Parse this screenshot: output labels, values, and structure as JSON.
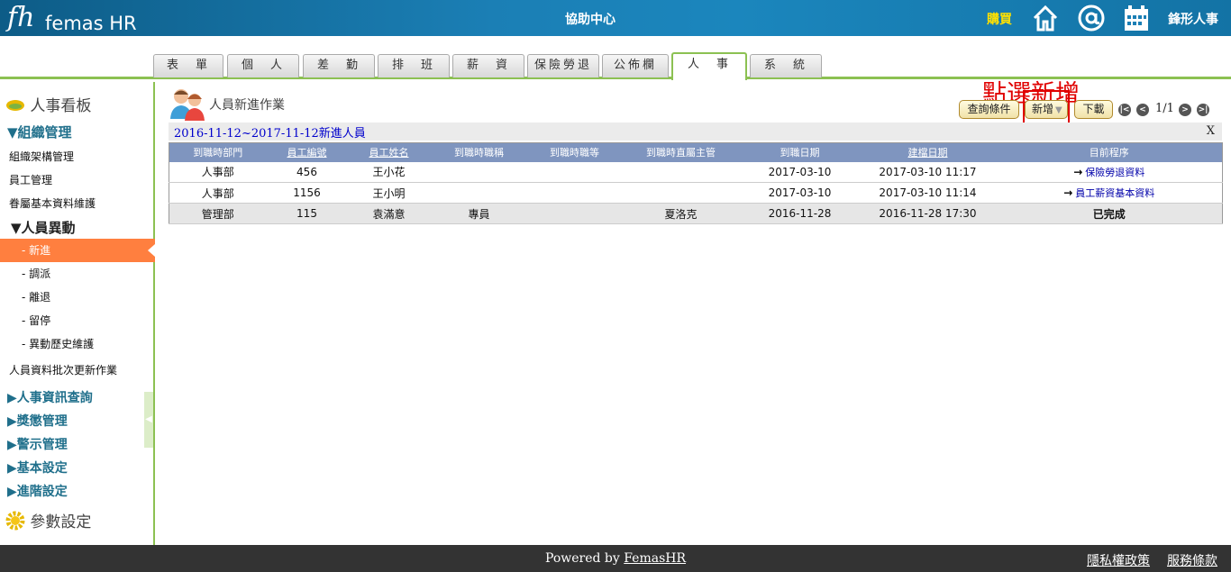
{
  "header": {
    "logo_mark": "fh",
    "logo_text": "femas HR",
    "help_center": "協助中心",
    "buy": "購買",
    "company": "鋒形人事",
    "icons": [
      "home-icon",
      "at-icon",
      "calendar-icon"
    ]
  },
  "tabs": [
    {
      "label": "表　單"
    },
    {
      "label": "個　人"
    },
    {
      "label": "差　勤"
    },
    {
      "label": "排　班"
    },
    {
      "label": "薪　資"
    },
    {
      "label": "保險勞退"
    },
    {
      "label": "公佈欄"
    },
    {
      "label": "人　事",
      "active": true
    },
    {
      "label": "系　統"
    }
  ],
  "annotation": "點選新增",
  "sidebar": {
    "board": "人事看板",
    "org_head": "▼組織管理",
    "org_items": [
      "組織架構管理",
      "員工管理",
      "眷屬基本資料維護"
    ],
    "change_head": "▼人員異動",
    "change_items": [
      "- 新進",
      "- 調派",
      "- 離退",
      "- 留停",
      "- 異動歷史維護"
    ],
    "batch": "人員資料批次更新作業",
    "sections": [
      "▶人事資訊查詢",
      "▶獎懲管理",
      "▶警示管理",
      "▶基本設定",
      "▶進階設定"
    ],
    "params": "參數設定"
  },
  "page": {
    "title": "人員新進作業",
    "buttons": {
      "query": "查詢條件",
      "add": "新增",
      "download": "下載"
    },
    "pager": {
      "first": "|<",
      "prev": "<",
      "next": ">",
      "last": ">|",
      "text": "1/1"
    },
    "range": "2016-11-12~2017-11-12新進人員",
    "close": "X"
  },
  "table": {
    "headers": [
      "到職時部門",
      "員工編號",
      "員工姓名",
      "到職時職稱",
      "到職時職等",
      "到職時直屬主管",
      "到職日期",
      "建檔日期",
      "目前程序"
    ],
    "rows": [
      {
        "dept": "人事部",
        "id": "456",
        "name": "王小花",
        "title": "",
        "grade": "",
        "boss": "",
        "start": "2017-03-10",
        "created": "2017-03-10 11:17",
        "proc": "保險勞退資料",
        "proc_link": true
      },
      {
        "dept": "人事部",
        "id": "1156",
        "name": "王小明",
        "title": "",
        "grade": "",
        "boss": "",
        "start": "2017-03-10",
        "created": "2017-03-10 11:14",
        "proc": "員工薪資基本資料",
        "proc_link": true
      },
      {
        "dept": "管理部",
        "id": "115",
        "name": "袁滿意",
        "title": "專員",
        "grade": "",
        "boss": "夏洛克",
        "start": "2016-11-28",
        "created": "2016-11-28 17:30",
        "proc": "已完成",
        "proc_link": false
      }
    ]
  },
  "footer": {
    "powered_prefix": "Powered by ",
    "powered_link": "FemasHR",
    "privacy": "隱私權政策",
    "terms": "服務條款"
  },
  "colors": {
    "topbar": "#1b7fb5",
    "accent_green": "#8cc152",
    "active_item": "#ff7f3f",
    "buy": "#ffe100",
    "annotation": "#e00000",
    "table_header": "#7f95bf"
  }
}
